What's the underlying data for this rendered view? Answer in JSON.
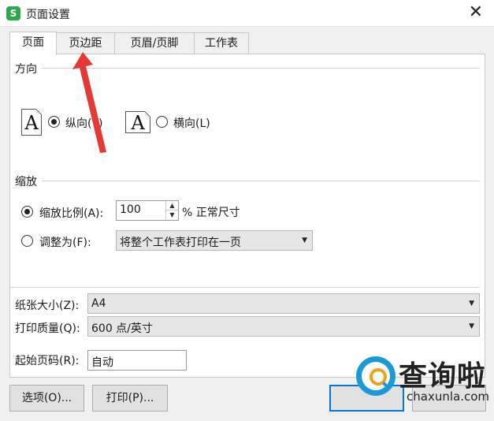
{
  "window": {
    "title": "页面设置",
    "app_icon_glyph": "S",
    "close_glyph": "✕"
  },
  "tabs": [
    {
      "label": "页面",
      "active": true
    },
    {
      "label": "页边距",
      "active": false
    },
    {
      "label": "页眉/页脚",
      "active": false
    },
    {
      "label": "工作表",
      "active": false
    }
  ],
  "orientation": {
    "title": "方向",
    "portrait_label": "纵向(T)",
    "landscape_label": "横向(L)",
    "selected": "portrait",
    "icon_glyph": "A"
  },
  "scaling": {
    "title": "缩放",
    "scale_label": "缩放比例(A):",
    "scale_value": "100",
    "scale_suffix": "% 正常尺寸",
    "fit_label": "调整为(F):",
    "fit_value": "将整个工作表打印在一页",
    "selected": "scale"
  },
  "paper": {
    "size_label": "纸张大小(Z):",
    "size_value": "A4",
    "quality_label": "打印质量(Q):",
    "quality_value": "600 点/英寸",
    "start_label": "起始页码(R):",
    "start_value": "自动"
  },
  "buttons": {
    "options": "选项(O)...",
    "print": "打印(P)..."
  },
  "watermark": {
    "text": "查询啦",
    "url": "chaxunla.com"
  },
  "colors": {
    "annotation_arrow": "#e53935",
    "accent": "#0078d7",
    "logo_green": "#2ea84f"
  }
}
